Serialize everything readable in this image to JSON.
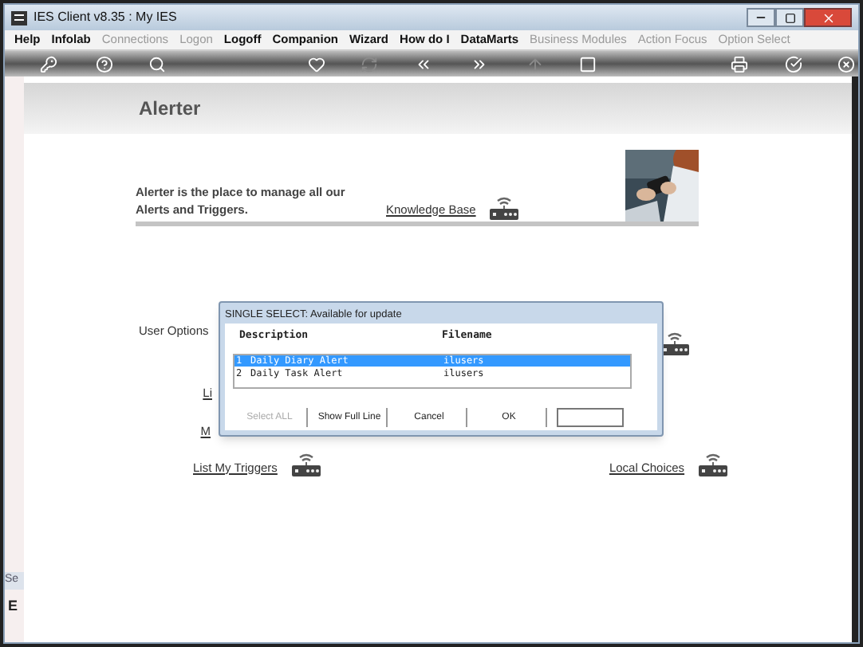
{
  "window": {
    "title": "IES Client v8.35 : My IES"
  },
  "menu": [
    {
      "label": "Help",
      "disabled": false
    },
    {
      "label": "Infolab",
      "disabled": false
    },
    {
      "label": "Connections",
      "disabled": true
    },
    {
      "label": "Logon",
      "disabled": true
    },
    {
      "label": "Logoff",
      "disabled": false
    },
    {
      "label": "Companion",
      "disabled": false
    },
    {
      "label": "Wizard",
      "disabled": false
    },
    {
      "label": "How do I",
      "disabled": false
    },
    {
      "label": "DataMarts",
      "disabled": false
    },
    {
      "label": "Business Modules",
      "disabled": true
    },
    {
      "label": "Action Focus",
      "disabled": true
    },
    {
      "label": "Option Select",
      "disabled": true
    }
  ],
  "toolbar": [
    {
      "disabled": false
    },
    {
      "disabled": false
    },
    {
      "disabled": false
    },
    {
      "disabled": false
    },
    {
      "disabled": true
    },
    {
      "disabled": false
    },
    {
      "disabled": false
    },
    {
      "disabled": true
    },
    {
      "disabled": false
    },
    {
      "disabled": false
    },
    {
      "disabled": false
    },
    {
      "disabled": false
    }
  ],
  "page": {
    "heading": "Alerter",
    "intro": "Alerter is the place to manage all our Alerts and Triggers.",
    "knowledge_link": "Knowledge Base",
    "section_label": "User Options",
    "links": [
      {
        "label": "Li"
      },
      {
        "label": "M"
      }
    ],
    "bottom_links": [
      {
        "label": "List My Triggers"
      },
      {
        "label": "Local Choices"
      }
    ]
  },
  "side_panel": {
    "label": "Se",
    "key": "E"
  },
  "dialog": {
    "title": "SINGLE SELECT: Available for update",
    "columns": [
      "Description",
      "Filename"
    ],
    "rows": [
      {
        "index": "1",
        "description": "Daily Diary Alert",
        "filename": "ilusers",
        "selected": true
      },
      {
        "index": "2",
        "description": "Daily Task Alert",
        "filename": "ilusers",
        "selected": false
      }
    ],
    "buttons": [
      {
        "label": "Select ALL",
        "disabled": true
      },
      {
        "label": "Show Full Line",
        "disabled": false
      },
      {
        "label": "Cancel",
        "disabled": false
      },
      {
        "label": "OK",
        "disabled": false
      }
    ]
  }
}
